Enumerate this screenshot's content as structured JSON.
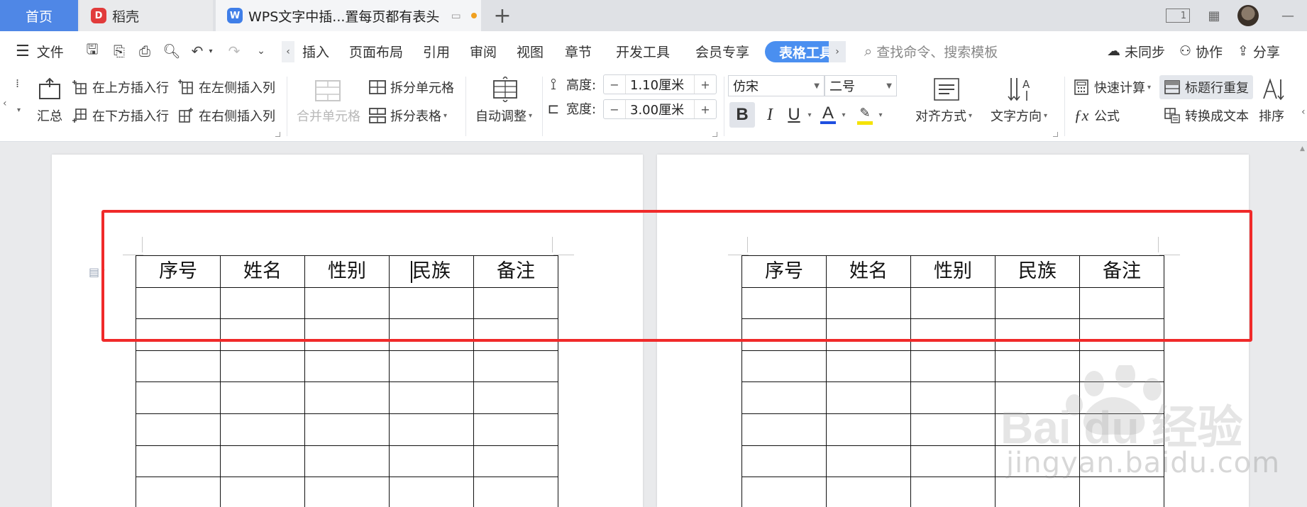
{
  "tabs": {
    "home": "首页",
    "daoke": "稻壳",
    "document": "WPS文字中插...置每页都有表头",
    "add_icon": "plus-icon"
  },
  "window": {
    "page_indicator": "1"
  },
  "menu": {
    "file": "文件",
    "items": [
      "插入",
      "页面布局",
      "引用",
      "审阅",
      "视图",
      "章节",
      "开发工具",
      "会员专享"
    ],
    "table_tools": "表格工具",
    "search_placeholder": "查找命令、搜索模板",
    "sync": "未同步",
    "collab": "协作",
    "share": "分享"
  },
  "ribbon": {
    "summary": "汇总",
    "insert_above": "在上方插入行",
    "insert_below": "在下方插入行",
    "insert_left": "在左侧插入列",
    "insert_right": "在右侧插入列",
    "merge_cells": "合并单元格",
    "split_cells": "拆分单元格",
    "split_table": "拆分表格",
    "auto_fit": "自动调整",
    "height_label": "高度:",
    "height_value": "1.10厘米",
    "width_label": "宽度:",
    "width_value": "3.00厘米",
    "font_name": "仿宋",
    "font_size": "二号",
    "align": "对齐方式",
    "text_direction": "文字方向",
    "quick_calc": "快速计算",
    "formula": "公式",
    "repeat_header": "标题行重复",
    "to_text": "转换成文本",
    "sort": "排序",
    "font_color": "#1f4fe0",
    "highlight_color": "#f5e300"
  },
  "doc": {
    "headers": [
      "序号",
      "姓名",
      "性别",
      "民族",
      "备注"
    ],
    "highlight_color": "#f02a2a"
  },
  "watermark": {
    "logo": "Bai du 经验",
    "url": "jingyan.baidu.com"
  }
}
